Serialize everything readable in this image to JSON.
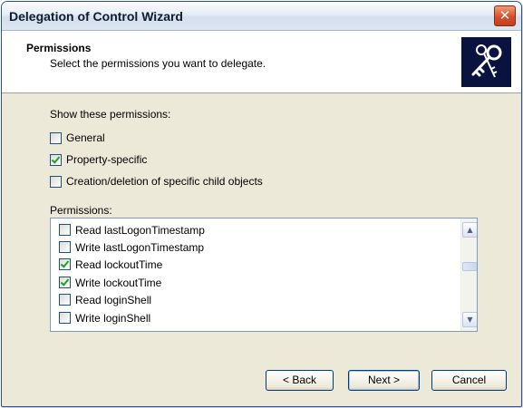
{
  "window": {
    "title": "Delegation of Control Wizard",
    "close_glyph": "✕"
  },
  "header": {
    "title": "Permissions",
    "subtitle": "Select the permissions you want to delegate.",
    "icon": "keys-icon"
  },
  "filters": {
    "label": "Show these permissions:",
    "options": [
      {
        "label": "General",
        "checked": false
      },
      {
        "label": "Property-specific",
        "checked": true
      },
      {
        "label": "Creation/deletion of specific child objects",
        "checked": false
      }
    ]
  },
  "permissions": {
    "label": "Permissions:",
    "items": [
      {
        "label": "Read lastLogonTimestamp",
        "checked": false
      },
      {
        "label": "Write lastLogonTimestamp",
        "checked": false
      },
      {
        "label": "Read lockoutTime",
        "checked": true
      },
      {
        "label": "Write lockoutTime",
        "checked": true
      },
      {
        "label": "Read loginShell",
        "checked": false
      },
      {
        "label": "Write loginShell",
        "checked": false
      }
    ]
  },
  "buttons": {
    "back": "< Back",
    "next": "Next >",
    "cancel": "Cancel"
  },
  "colors": {
    "window_bg": "#ece9d8",
    "title_text": "#0f1c2e",
    "check": "#21a121"
  }
}
